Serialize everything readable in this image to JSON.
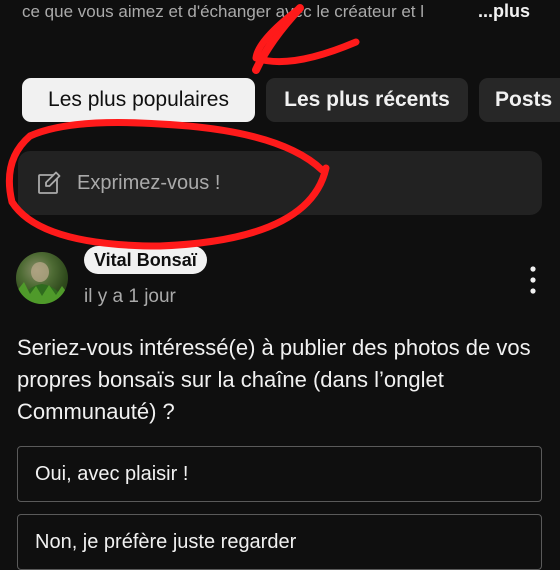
{
  "description": {
    "text": "ce que vous aimez et d'échanger avec le créateur et l",
    "more_label": "...plus"
  },
  "filters": [
    {
      "label": "Les plus populaires",
      "selected": true
    },
    {
      "label": "Les plus récents",
      "selected": false
    },
    {
      "label": "Posts",
      "selected": false
    }
  ],
  "composer": {
    "placeholder": "Exprimez-vous !",
    "icon": "edit-pencil-icon"
  },
  "post": {
    "author": "Vital Bonsaï",
    "time": "il y a 1 jour",
    "text": "Seriez-vous intéressé(e) à publier des photos de vos propres bonsaïs sur la chaîne (dans l’onglet Communauté) ?",
    "menu_icon": "more-vertical-icon",
    "poll_options": [
      "Oui, avec plaisir !",
      "Non, je préfère juste regarder"
    ]
  },
  "colors": {
    "background": "#0f0f0f",
    "chip": "#272727",
    "chip_active": "#f1f1f1",
    "annotation": "#ff1a1a"
  }
}
